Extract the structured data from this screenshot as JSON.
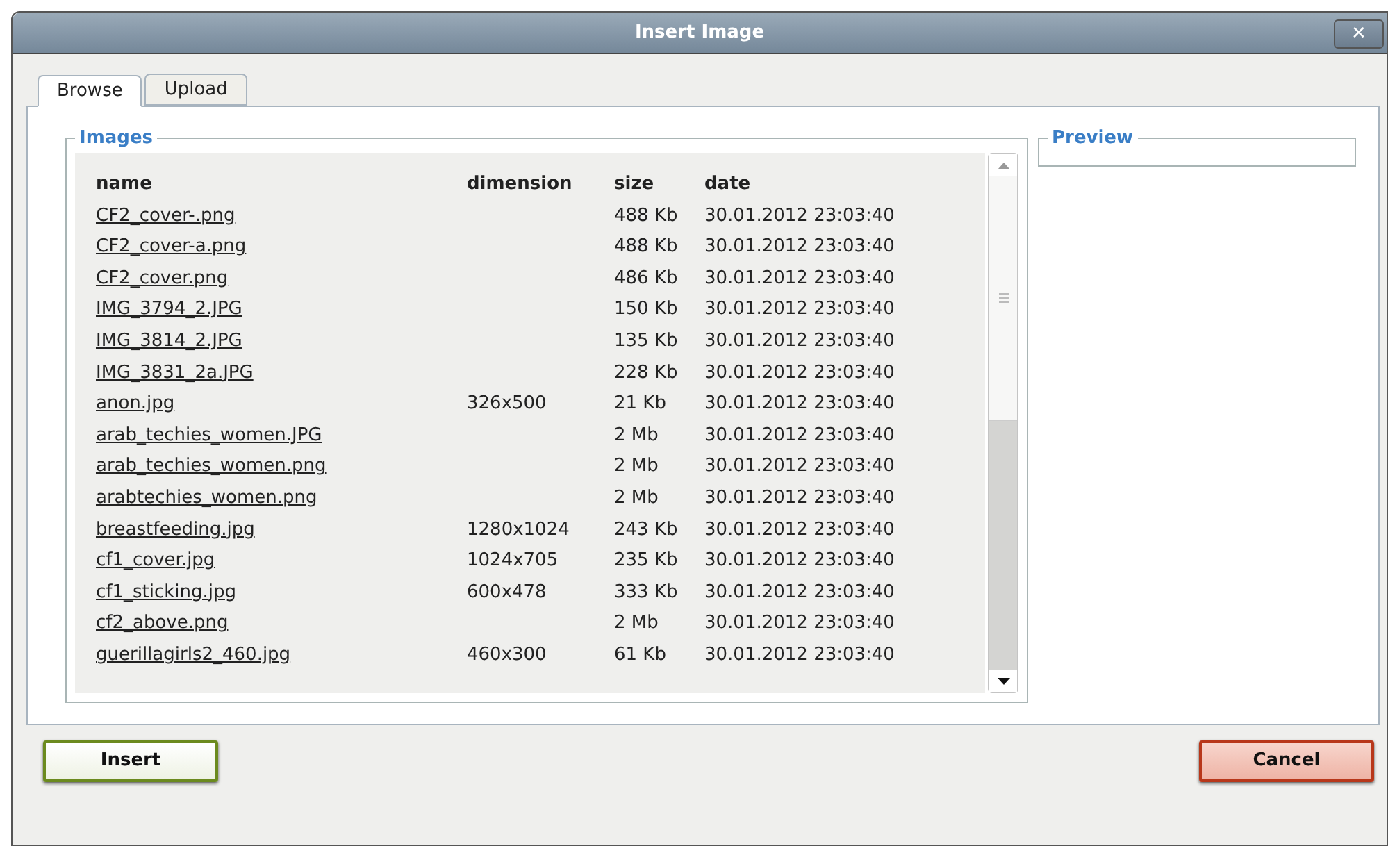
{
  "window": {
    "title": "Insert Image",
    "close": "✕"
  },
  "tabs": [
    {
      "label": "Browse",
      "selected": true
    },
    {
      "label": "Upload",
      "selected": false
    }
  ],
  "images": {
    "legend": "Images",
    "columns": [
      "name",
      "dimension",
      "size",
      "date"
    ],
    "rows": [
      [
        "CF2_cover-.png",
        "",
        "488 Kb",
        "30.01.2012 23:03:40"
      ],
      [
        "CF2_cover-a.png",
        "",
        "488 Kb",
        "30.01.2012 23:03:40"
      ],
      [
        "CF2_cover.png",
        "",
        "486 Kb",
        "30.01.2012 23:03:40"
      ],
      [
        "IMG_3794_2.JPG",
        "",
        "150 Kb",
        "30.01.2012 23:03:40"
      ],
      [
        "IMG_3814_2.JPG",
        "",
        "135 Kb",
        "30.01.2012 23:03:40"
      ],
      [
        "IMG_3831_2a.JPG",
        "",
        "228 Kb",
        "30.01.2012 23:03:40"
      ],
      [
        "anon.jpg",
        "326x500",
        "21 Kb",
        "30.01.2012 23:03:40"
      ],
      [
        "arab_techies_women.JPG",
        "",
        "2 Mb",
        "30.01.2012 23:03:40"
      ],
      [
        "arab_techies_women.png",
        "",
        "2 Mb",
        "30.01.2012 23:03:40"
      ],
      [
        "arabtechies_women.png",
        "",
        "2 Mb",
        "30.01.2012 23:03:40"
      ],
      [
        "breastfeeding.jpg",
        "1280x1024",
        "243 Kb",
        "30.01.2012 23:03:40"
      ],
      [
        "cf1_cover.jpg",
        "1024x705",
        "235 Kb",
        "30.01.2012 23:03:40"
      ],
      [
        "cf1_sticking.jpg",
        "600x478",
        "333 Kb",
        "30.01.2012 23:03:40"
      ],
      [
        "cf2_above.png",
        "",
        "2 Mb",
        "30.01.2012 23:03:40"
      ],
      [
        "guerillagirls2_460.jpg",
        "460x300",
        "61 Kb",
        "30.01.2012 23:03:40"
      ]
    ]
  },
  "preview": {
    "legend": "Preview"
  },
  "buttons": [
    {
      "label": "Insert",
      "kind": "confirm"
    },
    {
      "label": "Cancel",
      "kind": "cancel"
    }
  ]
}
